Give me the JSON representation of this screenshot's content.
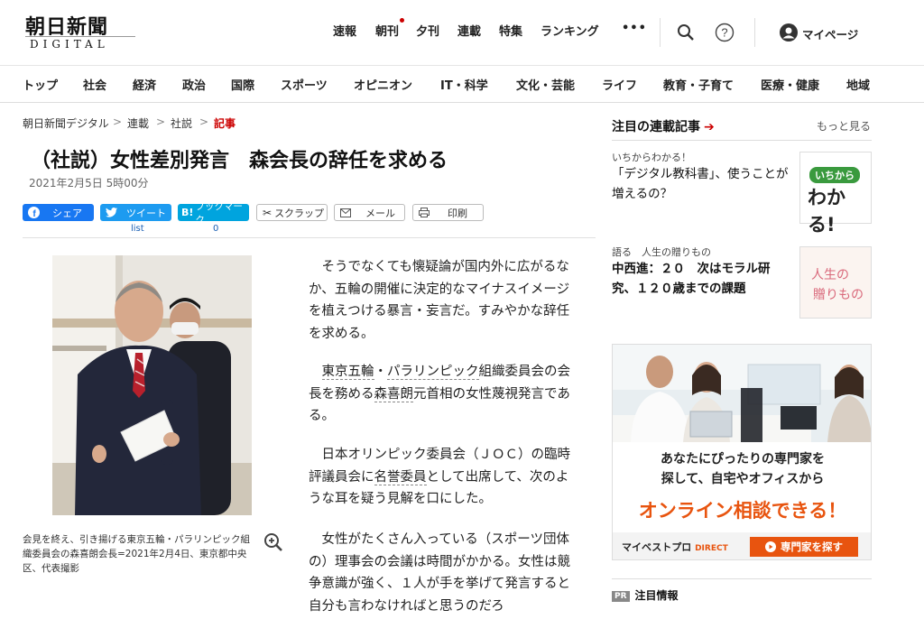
{
  "logo": {
    "jp": "朝日新聞",
    "en": "DIGITAL"
  },
  "topnav": {
    "items": [
      "速報",
      "朝刊",
      "夕刊",
      "連載",
      "特集",
      "ランキング"
    ],
    "more": "•••",
    "mypage": "マイページ"
  },
  "secnav": [
    "トップ",
    "社会",
    "経済",
    "政治",
    "国際",
    "スポーツ",
    "オピニオン",
    "IT・科学",
    "文化・芸能",
    "ライフ",
    "教育・子育て",
    "医療・健康",
    "地域"
  ],
  "breadcrumb": {
    "items": [
      "朝日新聞デジタル",
      "連載",
      "社説"
    ],
    "current": "記事",
    "sep": ">"
  },
  "article": {
    "title": "（社説）女性差別発言　森会長の辞任を求める",
    "date": "2021年2月5日  5時00分",
    "share": {
      "facebook": "シェア",
      "twitter": "ツイート",
      "hatena": "ブックマーク",
      "scrap": "スクラップ",
      "mail": "メール",
      "print": "印刷",
      "twitter_sub": "list",
      "hatena_sub": "0",
      "hatena_badge": "B!"
    },
    "caption": "会見を終え、引き揚げる東京五輪・パラリンピック組織委員会の森喜朗会長=2021年2月4日、東京都中央区、代表撮影",
    "p1": "そうでなくても懐疑論が国内外に広がるなか、五輪の開催に決定的なマイナスイメージを植えつける暴言・妄言だ。すみやかな辞任を求める。",
    "p2": {
      "link1": "東京五輪",
      "dot": "・",
      "link2": "パラリンピック",
      "a": "組織委員会の会長を務める",
      "link3": "森喜朗",
      "b": "元首相の女性蔑視発言である。"
    },
    "p3": {
      "a": "日本オリンピック委員会（ＪＯＣ）の臨時評議員会に",
      "link": "名誉委員",
      "b": "として出席して、次のような耳を疑う見解を口にした。"
    },
    "p4": "女性がたくさん入っている（スポーツ団体の）理事会の会議は時間がかかる。女性は競争意識が強く、１人が手を挙げて発言すると自分も言わなければと思うのだろ"
  },
  "sidebar": {
    "heading": "注目の連載記事",
    "arrow": "➔",
    "more": "もっと見る",
    "item1": {
      "series": "いちからわかる！",
      "title": "「デジタル教科書」、使うことが増えるの？",
      "thumb_small": "いちから",
      "thumb_big": "わかる!"
    },
    "item2": {
      "series": "語る　人生の贈りもの",
      "title": "中西進：２０　次はモラル研究、１２０歳までの課題",
      "thumb_line1": "人生の",
      "thumb_line2": "贈りもの"
    },
    "ad": {
      "line1": "あなたにぴったりの専門家を",
      "line2": "探して、自宅やオフィスから",
      "line3": "オンライン相談できる！",
      "brand": "マイベストプロ",
      "brand_sub": "DIRECT",
      "cta": "専門家を探す"
    },
    "pr": {
      "badge": "PR",
      "label": "注目情報"
    }
  },
  "colors": {
    "accent": "#c00000",
    "facebook": "#1877f2",
    "twitter": "#1d9bf0",
    "hatena": "#00a4de",
    "ad_orange": "#e8540f"
  }
}
